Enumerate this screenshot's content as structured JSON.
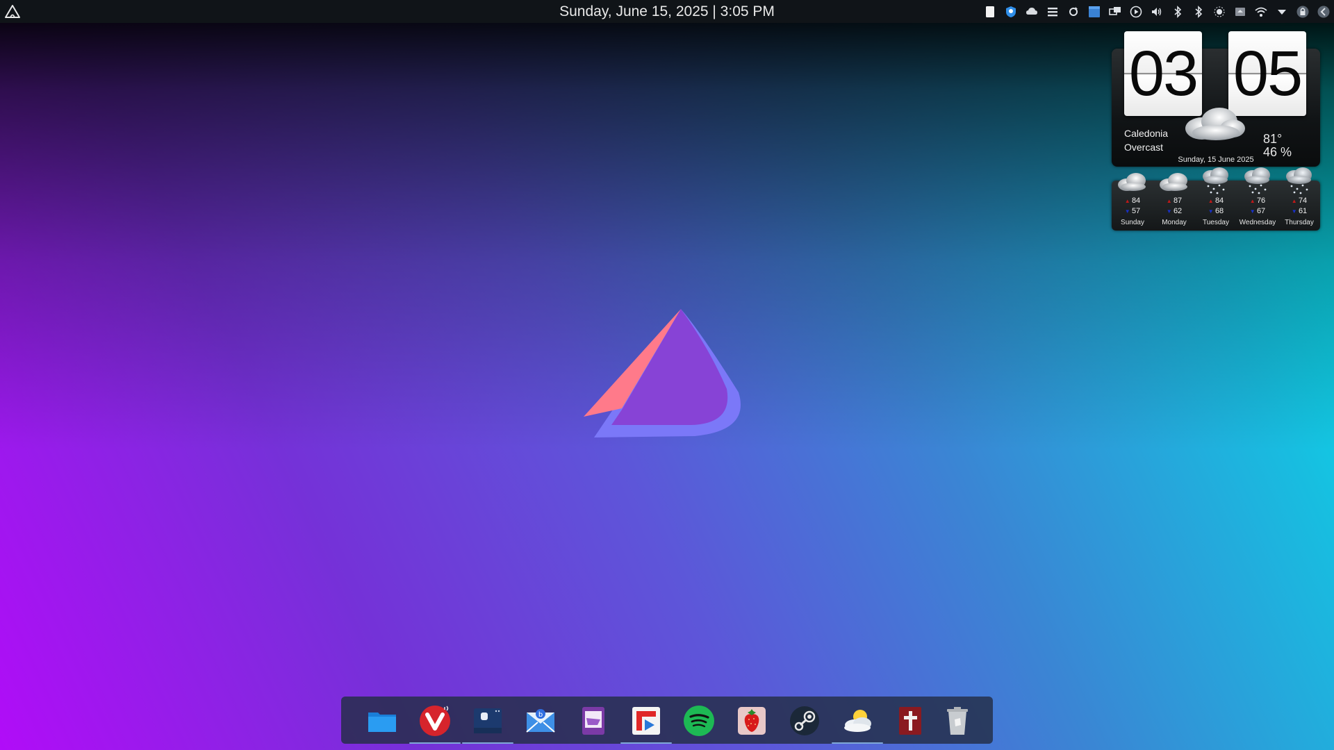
{
  "panel": {
    "datetime": "Sunday, June 15, 2025 | 3:05 PM",
    "launcher_icon": "arch-linux-icon",
    "tray_icons": [
      "clipboard-icon",
      "shield-icon",
      "cloud-sync-icon",
      "menu-icon",
      "refresh-icon",
      "window-icon",
      "display-icon",
      "play-icon",
      "volume-icon",
      "bluetooth-icon",
      "bluetooth-2-icon",
      "brightness-icon",
      "eject-icon",
      "wifi-icon",
      "chevron-down-icon",
      "lock-icon",
      "back-icon"
    ]
  },
  "weather": {
    "hours": "03",
    "minutes": "05",
    "city": "Caledonia",
    "condition": "Overcast",
    "temperature": "81°",
    "humidity": "46 %",
    "date": "Sunday, 15 June 2025",
    "forecast": [
      {
        "day": "Sunday",
        "high": "84",
        "low": "57",
        "icon": "cloudy-icon"
      },
      {
        "day": "Monday",
        "high": "87",
        "low": "62",
        "icon": "cloudy-icon"
      },
      {
        "day": "Tuesday",
        "high": "84",
        "low": "68",
        "icon": "snow-cloud-icon"
      },
      {
        "day": "Wednesday",
        "high": "76",
        "low": "67",
        "icon": "snow-cloud-icon"
      },
      {
        "day": "Thursday",
        "high": "74",
        "low": "61",
        "icon": "snow-cloud-icon"
      }
    ]
  },
  "dock": {
    "items": [
      {
        "name": "files-icon",
        "active": false
      },
      {
        "name": "vivaldi-icon",
        "active": true
      },
      {
        "name": "app-launcher-icon",
        "active": true
      },
      {
        "name": "mail-icon",
        "active": false
      },
      {
        "name": "purple-app-icon",
        "active": false
      },
      {
        "name": "flipboard-icon",
        "active": true
      },
      {
        "name": "spotify-icon",
        "active": false
      },
      {
        "name": "strawberry-icon",
        "active": false
      },
      {
        "name": "steam-icon",
        "active": false
      },
      {
        "name": "weather-app-icon",
        "active": true
      },
      {
        "name": "bible-icon",
        "active": false
      },
      {
        "name": "trash-icon",
        "active": false
      }
    ]
  },
  "colors": {
    "panel_bg": "#101418",
    "dock_bg": "#232d46",
    "accent": "#7fa8d8"
  }
}
